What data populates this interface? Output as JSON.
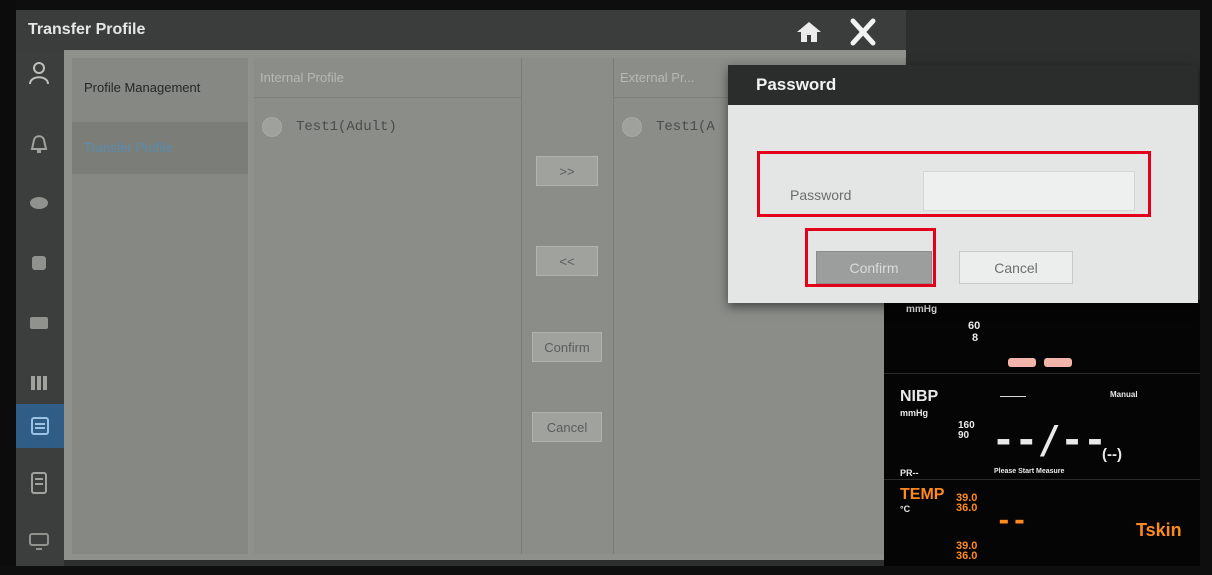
{
  "window": {
    "title": "Transfer Profile"
  },
  "nav": {
    "items": [
      {
        "label": "Profile Management"
      },
      {
        "label": "Transfer Profile"
      }
    ]
  },
  "internal": {
    "header": "Internal Profile",
    "profiles": [
      "Test1(Adult)"
    ]
  },
  "external": {
    "header": "External Pr...",
    "profiles": [
      "Test1(A"
    ]
  },
  "transfer_buttons": {
    "to_external": ">>",
    "to_internal": "<<",
    "confirm": "Confirm",
    "cancel": "Cancel"
  },
  "password_dialog": {
    "title": "Password",
    "field_label": "Password",
    "value": "",
    "confirm": "Confirm",
    "cancel": "Cancel"
  },
  "monitor": {
    "top_unit": "mmHg",
    "top_limit_high": "60",
    "top_limit_low": "8",
    "nibp": {
      "label": "NIBP",
      "unit": "mmHg",
      "limit_high": "160",
      "limit_low": "90",
      "mode": "Manual",
      "value": "--/--",
      "mean": "(--)",
      "pr": "PR--",
      "status": "Please Start Measure"
    },
    "temp": {
      "label": "TEMP",
      "unit": "°C",
      "limit_high": "39.0",
      "limit_low": "36.0",
      "limit_high_2": "39.0",
      "limit_low_2": "36.0",
      "value": "--",
      "site": "Tskin"
    }
  },
  "colors": {
    "highlight": "#e2001a",
    "active_nav": "#2f5d86",
    "temp_orange": "#ff8a1f",
    "bar_pink": "#f2b4ab"
  }
}
